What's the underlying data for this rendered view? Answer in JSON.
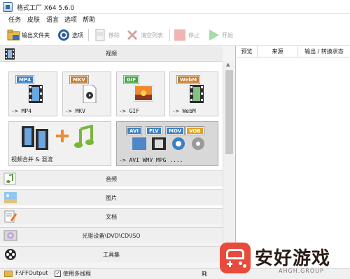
{
  "window": {
    "title": "格式工厂 X64 5.6.0"
  },
  "menu": [
    "任务",
    "皮肤",
    "语言",
    "选项",
    "帮助"
  ],
  "toolbar": {
    "output_folder": "输出文件夹",
    "options": "选项",
    "remove": "移除",
    "clear_list": "清空列表",
    "stop": "停止",
    "start": "开始"
  },
  "categories": {
    "video": "视频",
    "audio": "音频",
    "image": "图片",
    "document": "文档",
    "disc": "光驱设备\\DVD\\CD\\ISO",
    "tools": "工具集"
  },
  "video_tiles": [
    {
      "badge": "MP4",
      "label": "-> MP4",
      "color": "#3b7fc4",
      "icon": "film-icon"
    },
    {
      "badge": "MKV",
      "label": "-> MKV",
      "color": "#c47a2c",
      "icon": "document-icon"
    },
    {
      "badge": "GIF",
      "label": "-> GIF",
      "color": "#4aa34a",
      "icon": "sunset-photo-icon"
    },
    {
      "badge": "WebM",
      "label": "-> WebM",
      "color": "#c47a2c",
      "icon": "film-icon"
    }
  ],
  "video_big_tiles": {
    "merge_label": "视频合并 & 混流",
    "multi_label": "-> AVI WMV MPG ....",
    "multi_badges": [
      "AVI",
      "FLV",
      "MOV",
      "VOB"
    ],
    "badge_colors": [
      "#3b7fc4",
      "#3b7fc4",
      "#3b7fc4",
      "#e0a020"
    ]
  },
  "task_columns": [
    "预览",
    "来源",
    "输出 / 转换状态"
  ],
  "statusbar": {
    "output_path": "F:\\FFOutput",
    "multithread_label": "使用多线程",
    "multithread_checked": true,
    "right_text": "耗"
  },
  "watermark": {
    "title": "安好游戏",
    "url": "AHGH.GROUP"
  },
  "colors": {
    "accent": "#3a6aa8",
    "watermark_red": "#e84a3c"
  }
}
